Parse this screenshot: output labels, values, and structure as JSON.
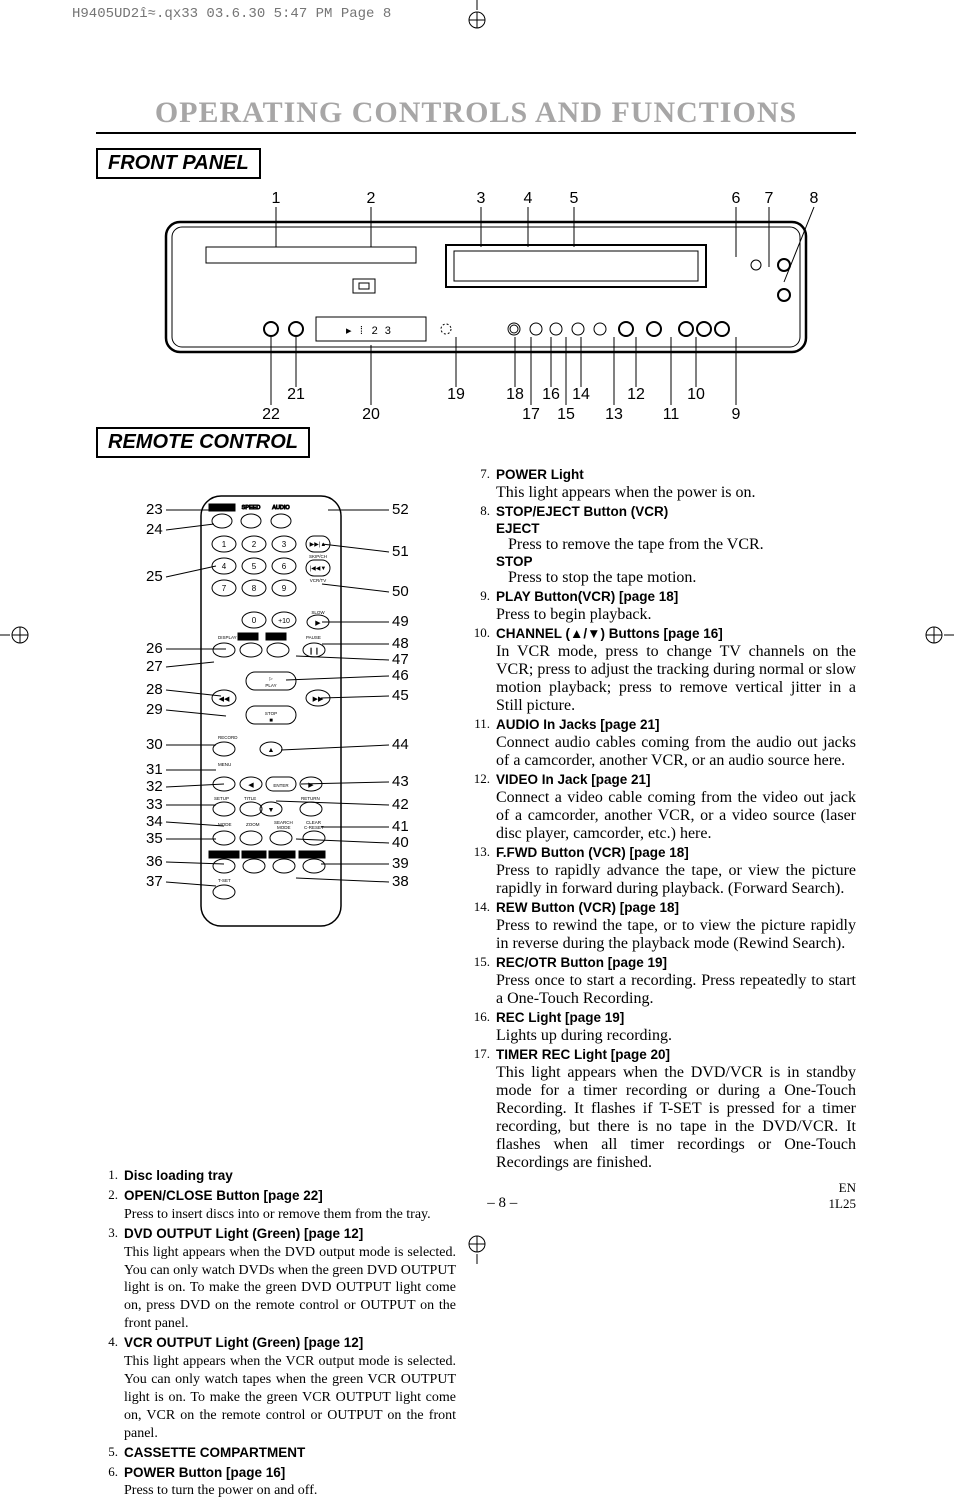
{
  "header_ref": "H9405UD2î≈.qx33  03.6.30 5:47 PM  Page 8",
  "title": "OPERATING CONTROLS AND FUNCTIONS",
  "front_panel_label": "FRONT PANEL",
  "remote_label": "REMOTE CONTROL",
  "front_numbers_top": [
    "1",
    "2",
    "3",
    "4",
    "5",
    "6",
    "7",
    "8"
  ],
  "front_numbers_bot_row1": [
    "21",
    "19",
    "18",
    "16",
    "14",
    "12",
    "10"
  ],
  "front_numbers_bot_row2": [
    "22",
    "20",
    "17",
    "15",
    "13",
    "11",
    "9"
  ],
  "remote_left_nums": [
    "23",
    "24",
    "25",
    "26",
    "27",
    "28",
    "29",
    "30",
    "31",
    "32",
    "33",
    "34",
    "35",
    "36",
    "37"
  ],
  "remote_right_nums": [
    "52",
    "51",
    "50",
    "49",
    "48",
    "47",
    "46",
    "45",
    "44",
    "43",
    "42",
    "41",
    "40",
    "39",
    "38"
  ],
  "remote_labels": {
    "power": "POWER",
    "speed": "SPEED",
    "audio": "AUDIO",
    "skip": "SKIP/CH",
    "vcrtv": "VCR/TV",
    "slow": "SLOW",
    "display": "DISPLAY",
    "dvd": "DVD",
    "vcr": "VCR",
    "pause": "PAUSE",
    "play": "PLAY",
    "stop": "STOP",
    "record": "RECORD",
    "menu": "MENU",
    "enter": "ENTER",
    "setup": "SETUP",
    "title": "TITLE",
    "return": "RETURN",
    "mode": "MODE",
    "zoom": "ZOOM",
    "search": "SEARCH\nMODE",
    "clear": "CLEAR\nC-RESET",
    "subtitle": "SUBTITLE",
    "angle": "ANGLE",
    "repeat": "REPEAT",
    "ab": "A-B",
    "tset": "T-SET",
    "plus10": "+10"
  },
  "col1": [
    {
      "n": "1.",
      "title": "Disc loading tray",
      "body": ""
    },
    {
      "n": "2.",
      "title": "OPEN/CLOSE Button [page 22]",
      "body": "Press to insert discs into or remove them from the tray."
    },
    {
      "n": "3.",
      "title": "DVD OUTPUT Light (Green) [page 12]",
      "body": "This light appears when the DVD output mode is selected. You can only watch DVDs when the green DVD OUTPUT light is on. To make the green DVD OUTPUT light come on, press DVD on the remote control or OUTPUT on the front panel."
    },
    {
      "n": "4.",
      "title": "VCR OUTPUT Light (Green) [page 12]",
      "body": "This light appears when the VCR output mode is selected. You can only watch tapes when the green VCR OUTPUT light is on. To make the green VCR OUTPUT light come on, VCR on the remote control or OUTPUT on the front panel."
    },
    {
      "n": "5.",
      "title": "CASSETTE COMPARTMENT",
      "body": ""
    },
    {
      "n": "6.",
      "title": "POWER Button [page 16]",
      "body": "Press to turn the power on and off."
    }
  ],
  "col2": [
    {
      "n": "7.",
      "title": "POWER Light",
      "body": "This light appears when the power is on."
    },
    {
      "n": "8.",
      "title": "STOP/EJECT Button (VCR)",
      "sub": [
        {
          "h": "EJECT",
          "t": "Press to remove the tape from the VCR."
        },
        {
          "h": "STOP",
          "t": "Press to stop the tape motion."
        }
      ]
    },
    {
      "n": "9.",
      "title": "PLAY Button(VCR) [page 18]",
      "body": "Press to begin playback."
    },
    {
      "n": "10.",
      "title": "CHANNEL (▲/▼) Buttons [page 16]",
      "body": "In VCR mode, press to change TV channels on the VCR; press to adjust the tracking during normal or slow motion playback; press to remove vertical jitter in a Still picture."
    },
    {
      "n": "11.",
      "title": "AUDIO In Jacks [page 21]",
      "body": "Connect audio cables coming from the audio out jacks of a camcorder, another VCR, or an audio source here."
    },
    {
      "n": "12.",
      "title": "VIDEO In Jack [page 21]",
      "body": "Connect a video cable coming from the video out jack of a camcorder, another VCR, or a video source (laser disc player, camcorder, etc.) here."
    },
    {
      "n": "13.",
      "title": "F.FWD Button (VCR) [page 18]",
      "body": "Press to rapidly advance the tape, or view the picture rapidly in forward during playback. (Forward Search)."
    },
    {
      "n": "14.",
      "title": "REW Button (VCR) [page 18]",
      "body": "Press to rewind the tape, or to view the picture rapidly in reverse during the playback mode (Rewind Search)."
    },
    {
      "n": "15.",
      "title": "REC/OTR Button [page 19]",
      "body": "Press once to start a recording. Press repeatedly to start a One-Touch Recording."
    },
    {
      "n": "16.",
      "title": "REC Light [page 19]",
      "body": "Lights up during recording."
    },
    {
      "n": "17.",
      "title": "TIMER REC Light [page 20]",
      "body": "This light appears when the DVD/VCR is in standby mode for a timer recording or during a One-Touch Recording. It flashes if T-SET is pressed for a timer recording, but there is no tape in the DVD/VCR. It flashes when all timer recordings or One-Touch Recordings are finished."
    }
  ],
  "footer": {
    "page": "– 8 –",
    "lang": "EN",
    "code": "1L25"
  }
}
